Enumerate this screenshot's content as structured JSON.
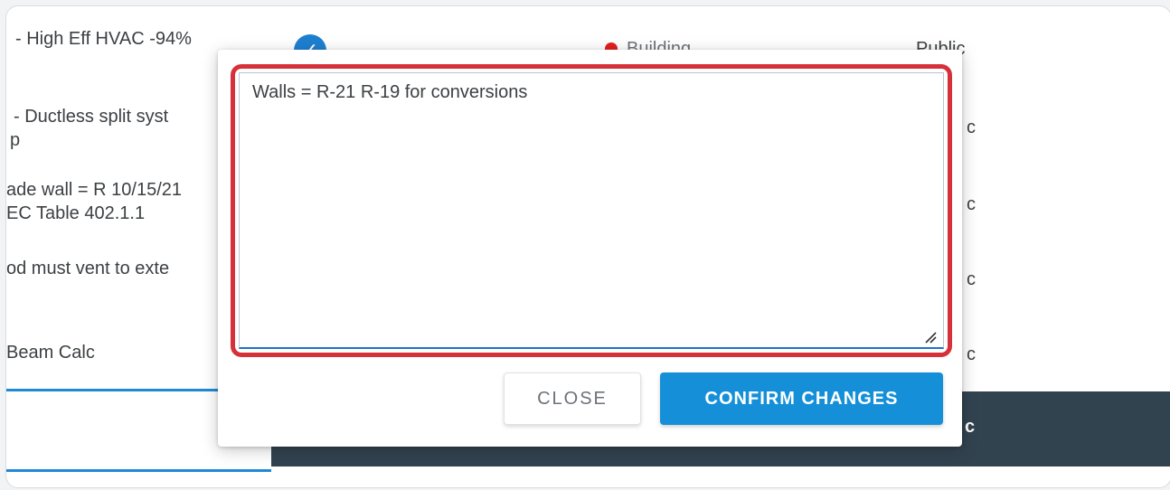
{
  "background": {
    "left_rows": [
      {
        "lines": [
          "- High Eff HVAC -94%"
        ]
      },
      {
        "lines": [
          "- Ductless split syst",
          "p"
        ]
      },
      {
        "lines": [
          "ade wall = R 10/15/21",
          "EC Table 402.1.1"
        ]
      },
      {
        "lines": [
          "od must vent to exte"
        ]
      },
      {
        "lines": [
          "Beam Calc"
        ]
      }
    ],
    "status_label": "Building",
    "visibility_labels": [
      "Public",
      "c",
      "c",
      "c",
      "c"
    ],
    "selected_row_visibility": "c"
  },
  "modal": {
    "textarea_value": "Walls = R-21 R-19 for conversions",
    "close_label": "CLOSE",
    "confirm_label": "CONFIRM CHANGES"
  },
  "colors": {
    "highlight": "#d6313a",
    "primary": "#1590d8",
    "dark_bar": "#324350",
    "status_dot": "#e21f1f"
  }
}
